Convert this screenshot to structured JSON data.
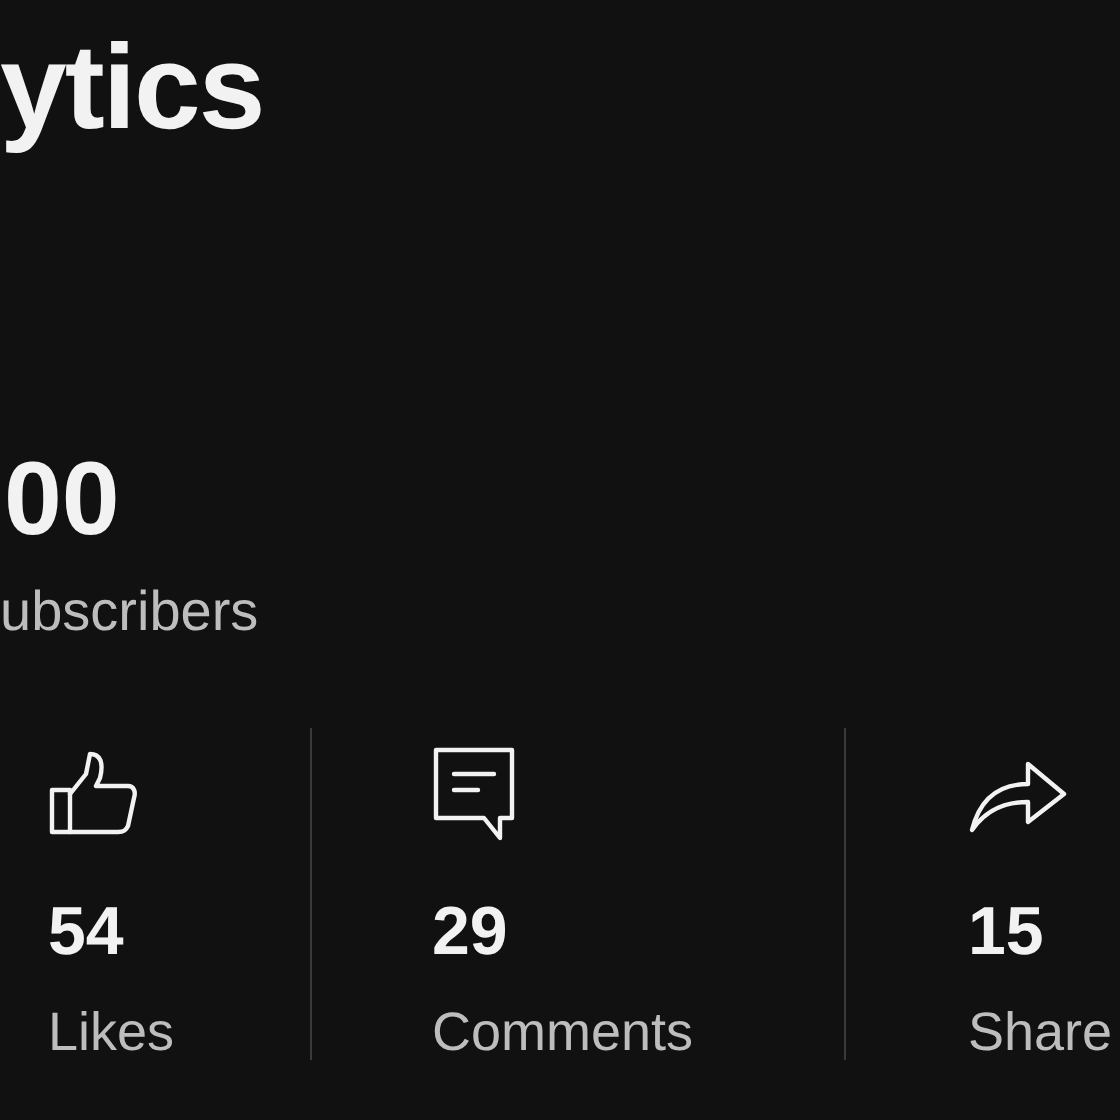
{
  "title": "ytics",
  "subscribers": {
    "count": "00",
    "label": "ubscribers"
  },
  "stats": [
    {
      "kind": "likes",
      "value": "54",
      "label": "Likes"
    },
    {
      "kind": "comments",
      "value": "29",
      "label": "Comments"
    },
    {
      "kind": "shares",
      "value": "15",
      "label": "Share"
    }
  ]
}
